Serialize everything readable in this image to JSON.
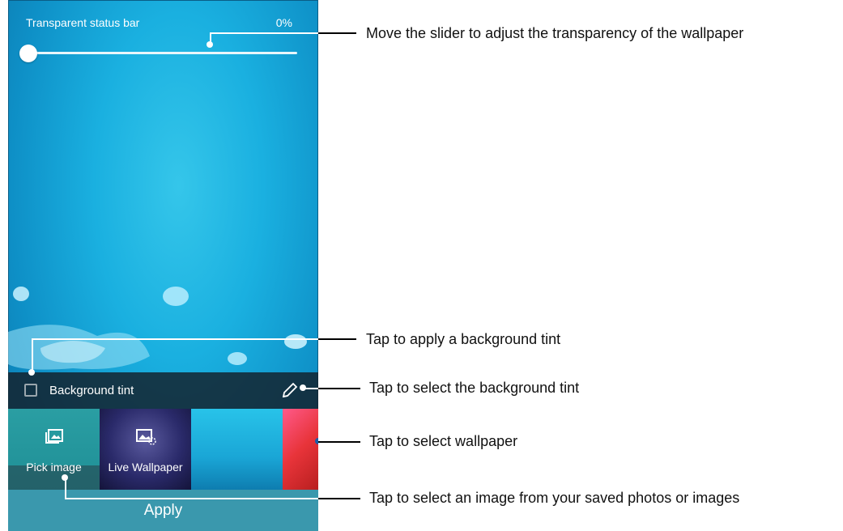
{
  "screen": {
    "status_bar_label": "Transparent status bar",
    "status_bar_value": "0%",
    "transparency_percent": 0,
    "background_tint_label": "Background tint",
    "background_tint_checked": false,
    "thumbnails": [
      {
        "label": "Pick image",
        "icon": "gallery-icon"
      },
      {
        "label": "Live Wallpaper",
        "icon": "live-wallpaper-icon"
      },
      {
        "label": "",
        "icon": ""
      },
      {
        "label": "",
        "icon": ""
      }
    ],
    "apply_label": "Apply"
  },
  "callouts": {
    "slider": "Move the slider to adjust the transparency of the wallpaper",
    "tint_apply": "Tap to apply a background tint",
    "tint_select": "Tap to select the background tint",
    "wallpaper": "Tap to select wallpaper",
    "pick_image": "Tap to select an image from your saved photos or images"
  },
  "colors": {
    "apply_bar": "#3a98ad",
    "tint_bar": "#1e2a33",
    "callout_line": "#000000"
  }
}
